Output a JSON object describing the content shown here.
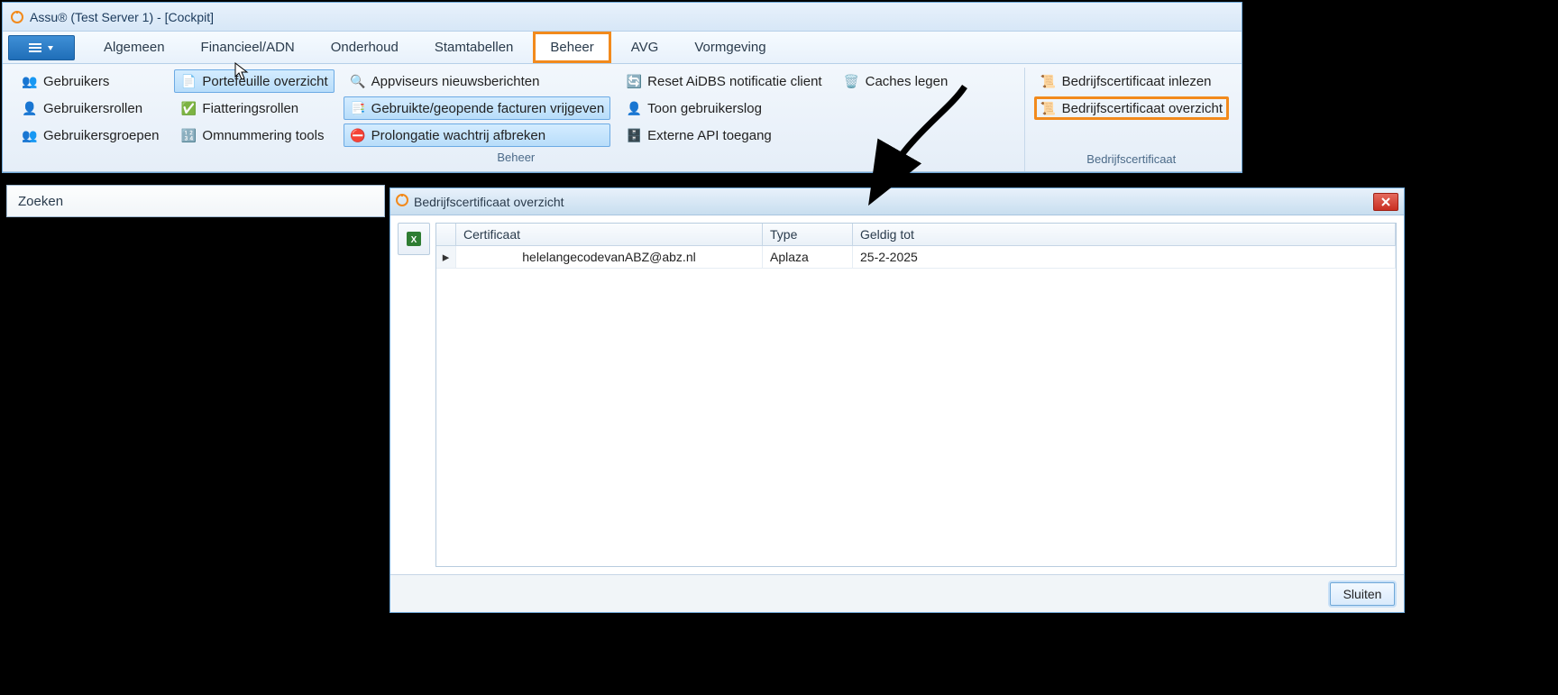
{
  "window": {
    "title": "Assu® (Test Server 1) - [Cockpit]"
  },
  "tabs": [
    {
      "label": "Algemeen"
    },
    {
      "label": "Financieel/ADN"
    },
    {
      "label": "Onderhoud"
    },
    {
      "label": "Stamtabellen"
    },
    {
      "label": "Beheer",
      "active": true
    },
    {
      "label": "AVG"
    },
    {
      "label": "Vormgeving"
    }
  ],
  "ribbon": {
    "group_beheer_label": "Beheer",
    "group_bedrijfscertificaat_label": "Bedrijfscertificaat",
    "col1": {
      "gebruikers": "Gebruikers",
      "gebruikersrollen": "Gebruikersrollen",
      "gebruikersgroepen": "Gebruikersgroepen"
    },
    "col2": {
      "portefeuille": "Portefeuille overzicht",
      "fiatteringsrollen": "Fiatteringsrollen",
      "omnummering": "Omnummering tools"
    },
    "col3": {
      "appviseurs": "Appviseurs nieuwsberichten",
      "facturen": "Gebruikte/geopende facturen vrijgeven",
      "prolongatie": "Prolongatie wachtrij afbreken"
    },
    "col4": {
      "reset": "Reset AiDBS notificatie client",
      "toon": "Toon gebruikerslog",
      "externe": "Externe API toegang"
    },
    "col5": {
      "caches": "Caches legen"
    },
    "col_cert": {
      "inlezen": "Bedrijfscertificaat inlezen",
      "overzicht": "Bedrijfscertificaat overzicht"
    }
  },
  "search": {
    "label": "Zoeken"
  },
  "dialog": {
    "title": "Bedrijfscertificaat overzicht",
    "columns": {
      "cert": "Certificaat",
      "type": "Type",
      "geldig": "Geldig tot"
    },
    "rows": [
      {
        "cert": "helelangecodevanABZ@abz.nl",
        "type": "Aplaza",
        "geldig": "25-2-2025"
      }
    ],
    "close_btn": "Sluiten"
  }
}
